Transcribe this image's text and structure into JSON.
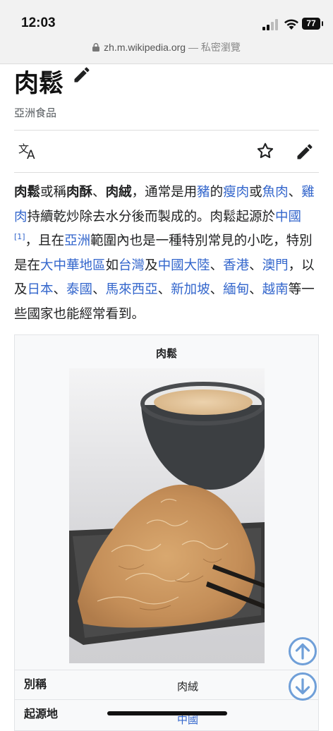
{
  "status_bar": {
    "time": "12:03",
    "battery": "77"
  },
  "browser": {
    "url": "zh.m.wikipedia.org",
    "mode": "— 私密瀏覽"
  },
  "article": {
    "title": "肉鬆",
    "description": "亞洲食品",
    "intro": [
      {
        "t": "肉鬆",
        "s": "bold"
      },
      {
        "t": "或稱"
      },
      {
        "t": "肉酥",
        "s": "bold"
      },
      {
        "t": "、"
      },
      {
        "t": "肉絨",
        "s": "bold"
      },
      {
        "t": "，通常是用"
      },
      {
        "t": "豬",
        "s": "link"
      },
      {
        "t": "的"
      },
      {
        "t": "瘦肉",
        "s": "link"
      },
      {
        "t": "或"
      },
      {
        "t": "魚肉",
        "s": "link"
      },
      {
        "t": "、"
      },
      {
        "t": "雞肉",
        "s": "link"
      },
      {
        "t": "持續乾炒除去水分後而製成的。肉鬆起源於"
      },
      {
        "t": "中國",
        "s": "link"
      },
      {
        "t": "[1]",
        "s": "sup"
      },
      {
        "t": "，且在"
      },
      {
        "t": "亞洲",
        "s": "link"
      },
      {
        "t": "範圍內也是一種特別常見的小吃，特別是在"
      },
      {
        "t": "大中華地區",
        "s": "link"
      },
      {
        "t": "如"
      },
      {
        "t": "台灣",
        "s": "link"
      },
      {
        "t": "及"
      },
      {
        "t": "中國大陸",
        "s": "link"
      },
      {
        "t": "、"
      },
      {
        "t": "香港",
        "s": "link"
      },
      {
        "t": "、"
      },
      {
        "t": "澳門",
        "s": "link"
      },
      {
        "t": "，以及"
      },
      {
        "t": "日本",
        "s": "link"
      },
      {
        "t": "、"
      },
      {
        "t": "泰國",
        "s": "link"
      },
      {
        "t": "、"
      },
      {
        "t": "馬來西亞",
        "s": "link"
      },
      {
        "t": "、"
      },
      {
        "t": "新加坡",
        "s": "link"
      },
      {
        "t": "、"
      },
      {
        "t": "緬甸",
        "s": "link"
      },
      {
        "t": "、"
      },
      {
        "t": "越南",
        "s": "link"
      },
      {
        "t": "等一些國家也能經常看到。"
      }
    ]
  },
  "infobox": {
    "title": "肉鬆",
    "rows": [
      {
        "label": "別稱",
        "value": "肉絨"
      },
      {
        "label": "起源地",
        "value": "中國"
      }
    ]
  },
  "colors": {
    "link": "#3366cc",
    "text": "#202122",
    "icon": "#202122",
    "scroll_button": "#6f9fd8"
  }
}
